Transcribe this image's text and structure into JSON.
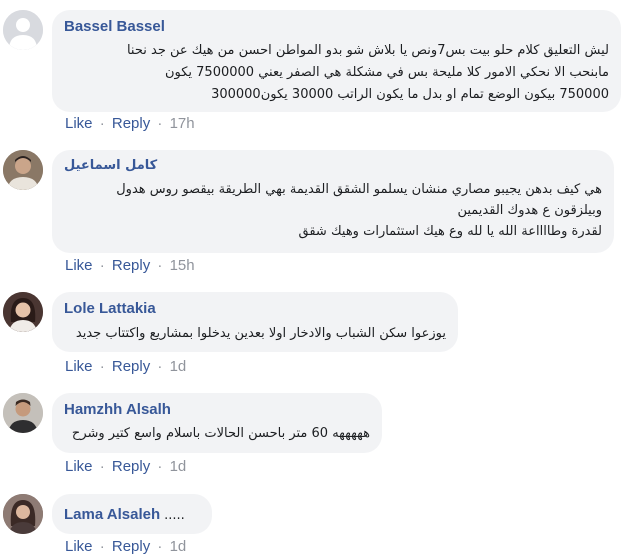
{
  "actions": {
    "like": "Like",
    "reply": "Reply",
    "dot": "·"
  },
  "comments": [
    {
      "author": "Bassel Bassel",
      "text": "ليش التعليق كلام حلو بيت بس7ونص يا بلاش شو بدو المواطن احسن من هيك عن جد نحنا\nمابنحب الا نحكي الامور كلا مليحة بس في مشكلة هي الصفر يعني 7500000 يكون\n750000 بيكون الوضع تمام او بدل ما يكون الراتب 30000 يكون300000",
      "time": "17h"
    },
    {
      "author": "كامل اسماعيل",
      "text": "هي كيف بدهن يجيبو مصاري منشان يسلمو الشقق القديمة بهي الطريقة بيقصو روس هدول\nوبيلزقون ع هدوك القديمين\nلقدرة وطااااعة الله يا لله وع هيك استثمارات وهيك شقق",
      "time": "15h"
    },
    {
      "author": "Lole Lattakia",
      "text": "يوزعوا سكن الشباب والادخار اولا بعدين يدخلوا بمشاريع واكتتاب جديد",
      "time": "1d"
    },
    {
      "author": "Hamzhh Alsalh",
      "text": "هههههه 60 متر باحسن الحالات باسلام واسع كتير وشرح",
      "time": "1d"
    },
    {
      "author": "Lama Alsaleh",
      "text": ".....",
      "time": "1d"
    }
  ]
}
